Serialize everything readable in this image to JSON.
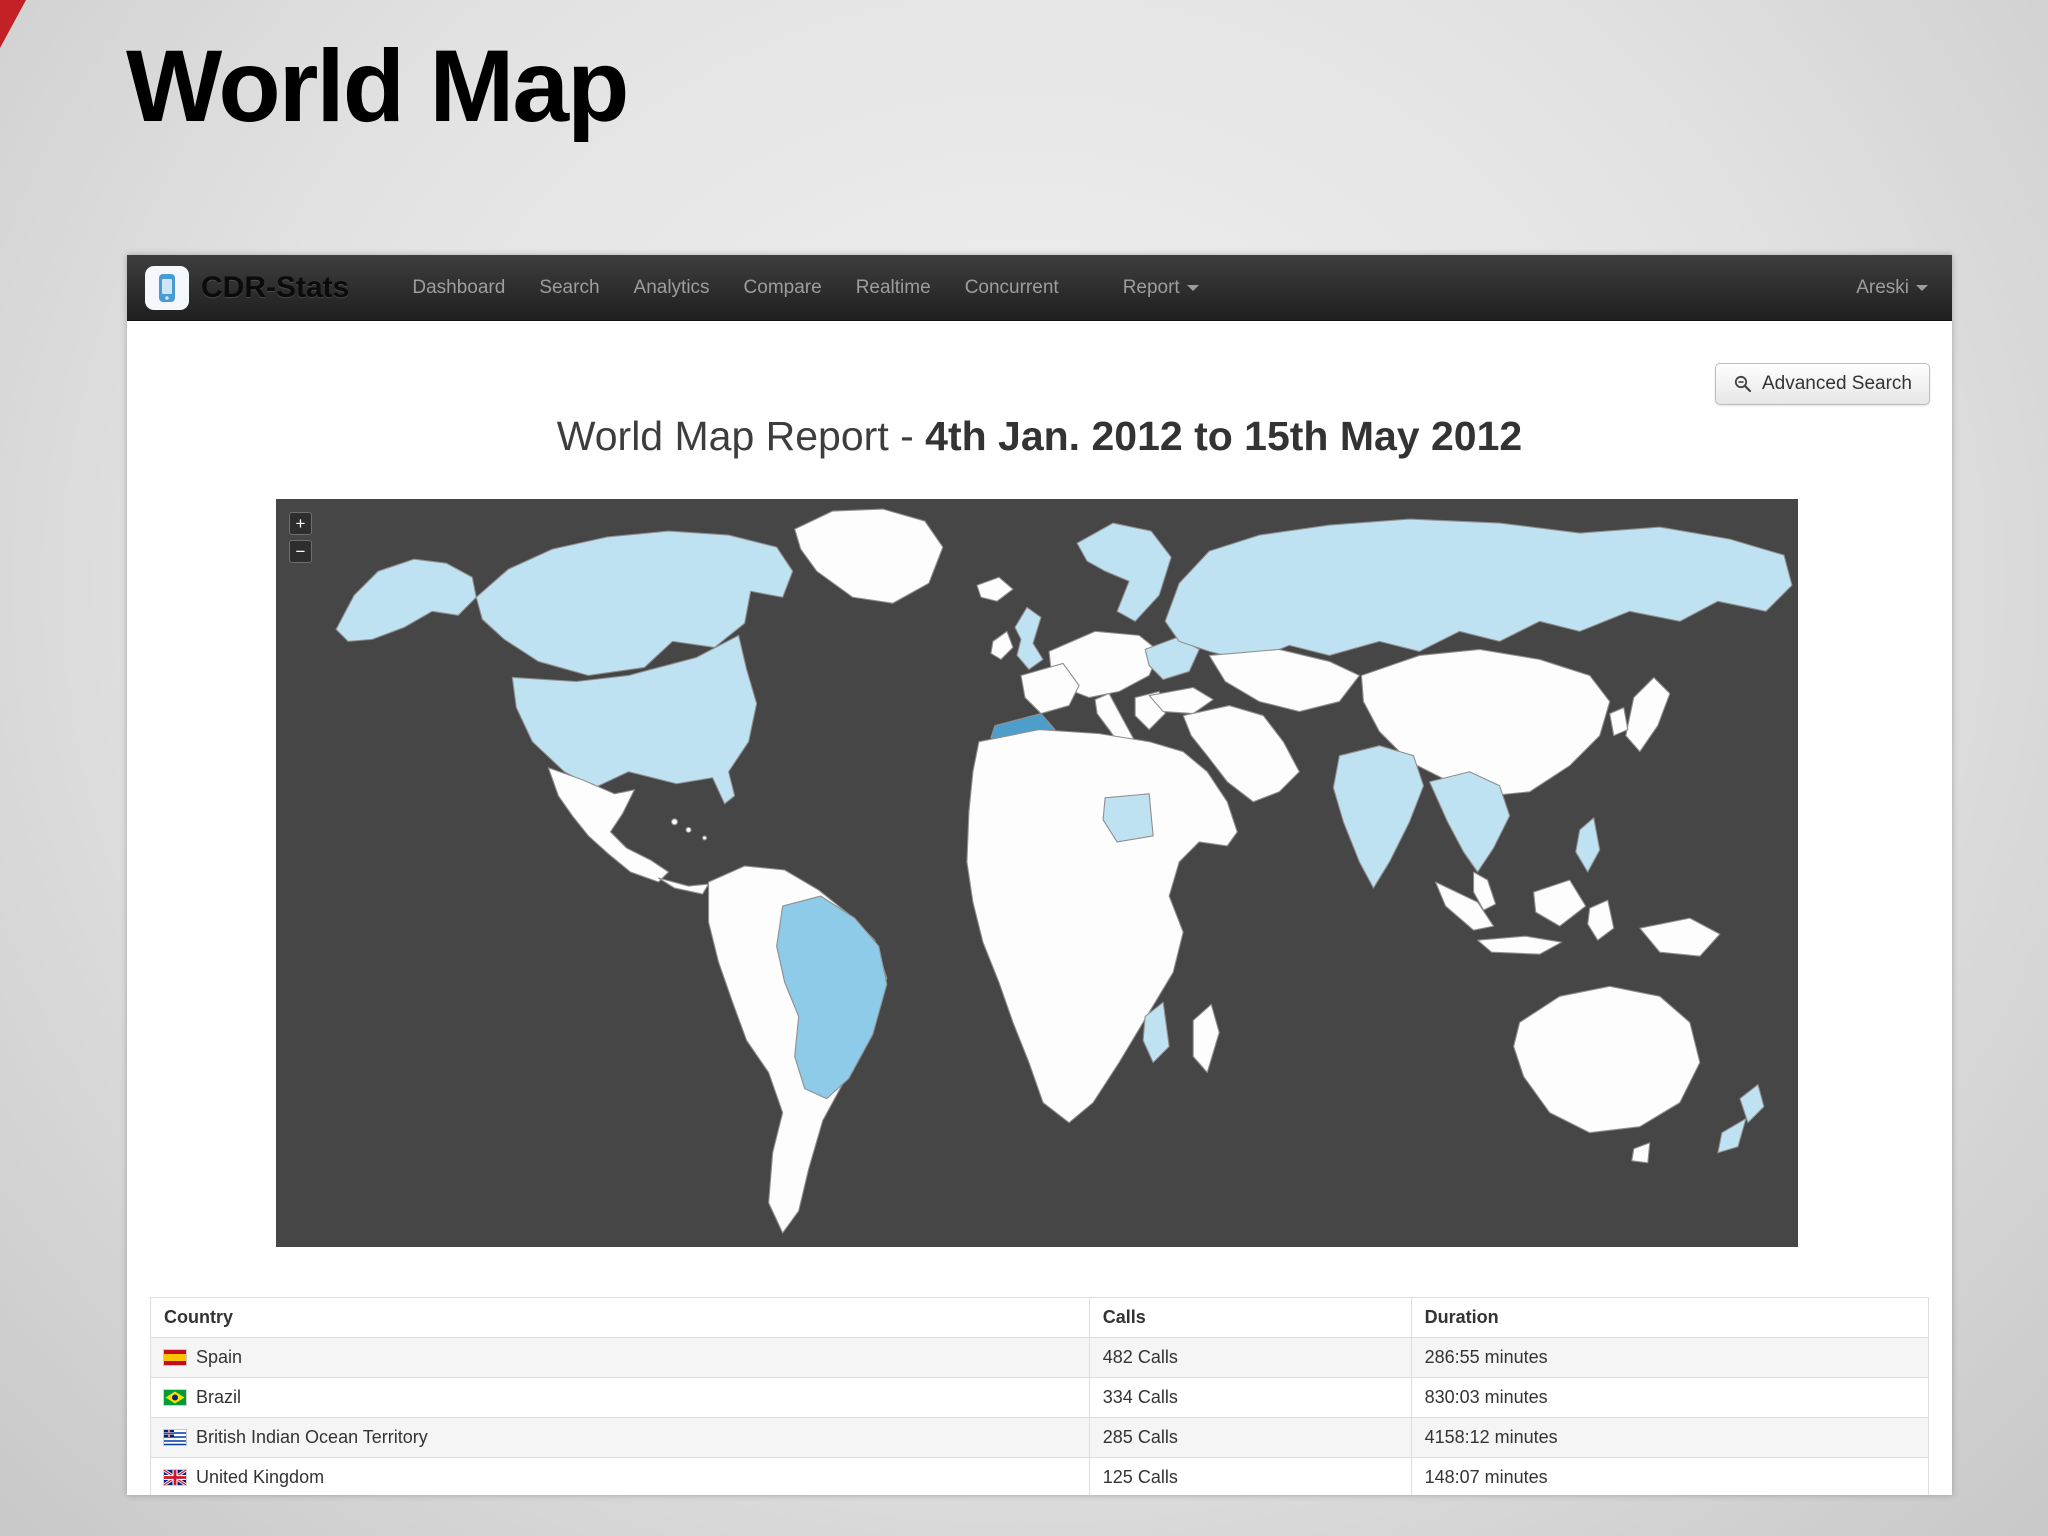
{
  "slide": {
    "title": "World Map"
  },
  "navbar": {
    "brand": "CDR-Stats",
    "items": [
      "Dashboard",
      "Search",
      "Analytics",
      "Compare",
      "Realtime",
      "Concurrent"
    ],
    "report_menu_label": "Report",
    "user_menu_label": "Areski"
  },
  "toolbar": {
    "advanced_search_label": "Advanced Search"
  },
  "report": {
    "title_prefix": "World Map Report - ",
    "title_range": "4th Jan. 2012 to 15th May 2012"
  },
  "map": {
    "zoom_in_label": "+",
    "zoom_out_label": "−",
    "colors": {
      "background": "#464646",
      "country": "#fdfdfd",
      "low": "#bfe2f2",
      "medium": "#8ecbe8",
      "high": "#4e9ecb"
    }
  },
  "table": {
    "headers": [
      "Country",
      "Calls",
      "Duration"
    ],
    "rows": [
      {
        "flag": "spain-flag",
        "country": "Spain",
        "calls": "482 Calls",
        "duration": "286:55 minutes"
      },
      {
        "flag": "brazil-flag",
        "country": "Brazil",
        "calls": "334 Calls",
        "duration": "830:03 minutes"
      },
      {
        "flag": "biot-flag",
        "country": "British Indian Ocean Territory",
        "calls": "285 Calls",
        "duration": "4158:12 minutes"
      },
      {
        "flag": "uk-flag",
        "country": "United Kingdom",
        "calls": "125 Calls",
        "duration": "148:07 minutes"
      }
    ]
  }
}
